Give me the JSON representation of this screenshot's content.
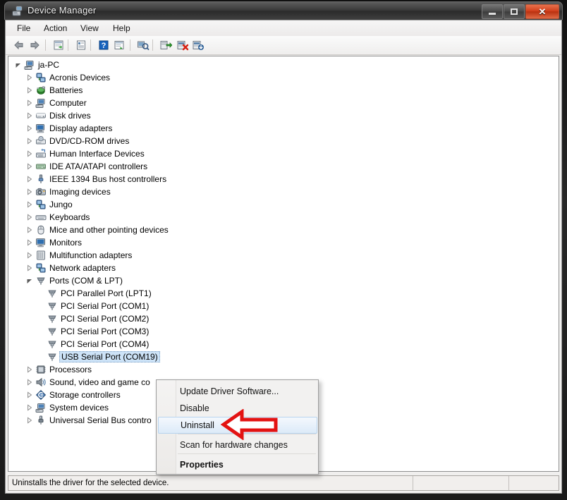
{
  "window": {
    "title": "Device Manager",
    "icon": "device-manager-icon",
    "controls": {
      "minimize": "Minimize",
      "maximize": "Maximize",
      "close": "Close"
    }
  },
  "menubar": {
    "items": [
      "File",
      "Action",
      "View",
      "Help"
    ]
  },
  "toolbar": {
    "buttons": [
      "back-icon",
      "forward-icon",
      "separator",
      "show-hidden-devices-icon",
      "separator",
      "properties-icon",
      "separator",
      "help-icon",
      "update-driver-icon",
      "separator",
      "scan-for-hardware-changes-icon",
      "separator",
      "update-driver-software-icon",
      "disable-device-icon",
      "enable-device-icon"
    ]
  },
  "tree": {
    "root": {
      "label": "ja-PC",
      "icon": "computer-icon",
      "expanded": true
    },
    "items": [
      {
        "label": "Acronis Devices",
        "icon": "network-icon",
        "level": 1,
        "state": "collapsed"
      },
      {
        "label": "Batteries",
        "icon": "battery-icon",
        "level": 1,
        "state": "collapsed"
      },
      {
        "label": "Computer",
        "icon": "computer-icon",
        "level": 1,
        "state": "collapsed"
      },
      {
        "label": "Disk drives",
        "icon": "disk-icon",
        "level": 1,
        "state": "collapsed"
      },
      {
        "label": "Display adapters",
        "icon": "display-icon",
        "level": 1,
        "state": "collapsed"
      },
      {
        "label": "DVD/CD-ROM drives",
        "icon": "dvd-icon",
        "level": 1,
        "state": "collapsed"
      },
      {
        "label": "Human Interface Devices",
        "icon": "hid-icon",
        "level": 1,
        "state": "collapsed"
      },
      {
        "label": "IDE ATA/ATAPI controllers",
        "icon": "ide-icon",
        "level": 1,
        "state": "collapsed"
      },
      {
        "label": "IEEE 1394 Bus host controllers",
        "icon": "ieee1394-icon",
        "level": 1,
        "state": "collapsed"
      },
      {
        "label": "Imaging devices",
        "icon": "camera-icon",
        "level": 1,
        "state": "collapsed"
      },
      {
        "label": "Jungo",
        "icon": "network-icon",
        "level": 1,
        "state": "collapsed"
      },
      {
        "label": "Keyboards",
        "icon": "keyboard-icon",
        "level": 1,
        "state": "collapsed"
      },
      {
        "label": "Mice and other pointing devices",
        "icon": "mouse-icon",
        "level": 1,
        "state": "collapsed"
      },
      {
        "label": "Monitors",
        "icon": "monitor-icon",
        "level": 1,
        "state": "collapsed"
      },
      {
        "label": "Multifunction adapters",
        "icon": "multifunction-icon",
        "level": 1,
        "state": "collapsed"
      },
      {
        "label": "Network adapters",
        "icon": "network-icon",
        "level": 1,
        "state": "collapsed"
      },
      {
        "label": "Ports (COM & LPT)",
        "icon": "port-icon",
        "level": 1,
        "state": "expanded"
      },
      {
        "label": "PCI Parallel Port (LPT1)",
        "icon": "port-icon",
        "level": 2,
        "state": "leaf"
      },
      {
        "label": "PCI Serial Port (COM1)",
        "icon": "port-icon",
        "level": 2,
        "state": "leaf"
      },
      {
        "label": "PCI Serial Port (COM2)",
        "icon": "port-icon",
        "level": 2,
        "state": "leaf"
      },
      {
        "label": "PCI Serial Port (COM3)",
        "icon": "port-icon",
        "level": 2,
        "state": "leaf"
      },
      {
        "label": "PCI Serial Port (COM4)",
        "icon": "port-icon",
        "level": 2,
        "state": "leaf"
      },
      {
        "label": "USB Serial Port (COM19)",
        "icon": "port-icon",
        "level": 2,
        "state": "leaf",
        "selected": true
      },
      {
        "label": "Processors",
        "icon": "processor-icon",
        "level": 1,
        "state": "collapsed"
      },
      {
        "label": "Sound, video and game co",
        "icon": "sound-icon",
        "level": 1,
        "state": "collapsed"
      },
      {
        "label": "Storage controllers",
        "icon": "storage-icon",
        "level": 1,
        "state": "collapsed"
      },
      {
        "label": "System devices",
        "icon": "computer-icon",
        "level": 1,
        "state": "collapsed"
      },
      {
        "label": "Universal Serial Bus contro",
        "icon": "usb-icon",
        "level": 1,
        "state": "collapsed"
      }
    ]
  },
  "context_menu": {
    "items": [
      {
        "label": "Update Driver Software...",
        "highlighted": false,
        "bold": false
      },
      {
        "label": "Disable",
        "highlighted": false,
        "bold": false
      },
      {
        "label": "Uninstall",
        "highlighted": true,
        "bold": false
      },
      {
        "label": "Scan for hardware changes",
        "highlighted": false,
        "bold": false
      },
      {
        "label": "Properties",
        "highlighted": false,
        "bold": true
      }
    ]
  },
  "annotation": {
    "shape": "left-arrow",
    "color": "#e31212",
    "points_to": "Uninstall"
  },
  "statusbar": {
    "text": "Uninstalls the driver for the selected device.",
    "pane2": "",
    "pane3": ""
  },
  "colors": {
    "selection": "#cde3f7",
    "menu_highlight": "#dceaf8",
    "annotation_red": "#e31212"
  }
}
